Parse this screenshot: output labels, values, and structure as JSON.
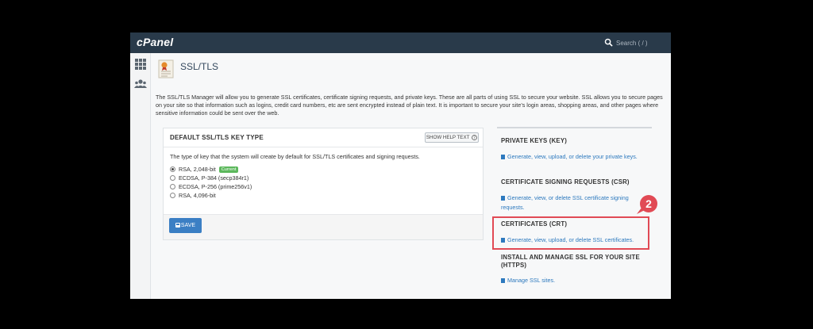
{
  "app": {
    "logo": "cPanel"
  },
  "search": {
    "placeholder": "Search ( / )"
  },
  "page": {
    "title": "SSL/TLS",
    "intro": "The SSL/TLS Manager will allow you to generate SSL certificates, certificate signing requests, and private keys. These are all parts of using SSL to secure your website. SSL allows you to secure pages on your site so that information such as logins, credit card numbers, etc are sent encrypted instead of plain text. It is important to secure your site’s login areas, shopping areas, and other pages where sensitive information could be sent over the web."
  },
  "key_panel": {
    "title": "DEFAULT SSL/TLS KEY TYPE",
    "help_button": "SHOW HELP TEXT",
    "description": "The type of key that the system will create by default for SSL/TLS certificates and signing requests.",
    "options": [
      {
        "label": "RSA, 2,048-bit",
        "selected": true,
        "badge": "Current"
      },
      {
        "label": "ECDSA, P-384 (secp384r1)",
        "selected": false
      },
      {
        "label": "ECDSA, P-256 (prime256v1)",
        "selected": false
      },
      {
        "label": "RSA, 4,096-bit",
        "selected": false
      }
    ],
    "save_label": "SAVE"
  },
  "right_panel": {
    "sections": [
      {
        "heading": "PRIVATE KEYS (KEY)",
        "link": "Generate, view, upload, or delete your private keys."
      },
      {
        "heading": "CERTIFICATE SIGNING REQUESTS (CSR)",
        "link": "Generate, view, or delete SSL certificate signing requests."
      },
      {
        "heading": "CERTIFICATES (CRT)",
        "link": "Generate, view, upload, or delete SSL certificates."
      },
      {
        "heading": "INSTALL AND MANAGE SSL FOR YOUR SITE (HTTPS)",
        "link": "Manage SSL sites."
      }
    ]
  },
  "annotation": {
    "step_number": "2"
  },
  "colors": {
    "topbar": "#293a4a",
    "link": "#2d79be",
    "save_button": "#3b7fc4",
    "highlight": "#e14a55",
    "badge": "#5cb85c"
  },
  "icons": [
    "search-icon",
    "apps-grid-icon",
    "users-icon",
    "certificate-icon",
    "question-icon",
    "save-icon",
    "document-icon"
  ]
}
